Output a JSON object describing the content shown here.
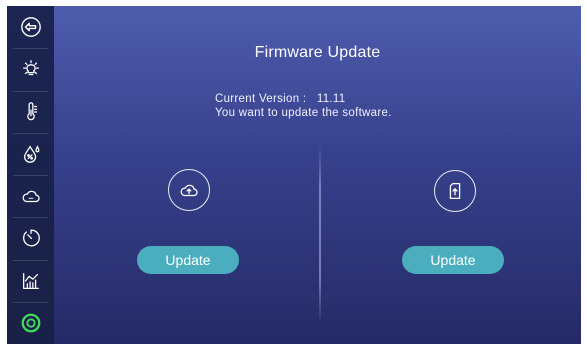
{
  "sidebar": {
    "items": [
      {
        "icon": "back-arrow-icon"
      },
      {
        "icon": "light-bulb-icon"
      },
      {
        "icon": "thermometer-icon"
      },
      {
        "icon": "humidity-icon"
      },
      {
        "icon": "cloud-icon"
      },
      {
        "icon": "timer-icon"
      },
      {
        "icon": "chart-icon"
      },
      {
        "icon": "power-ring-icon"
      }
    ],
    "active_color": "#3ddc5a"
  },
  "main": {
    "title": "Firmware Update",
    "version_label": "Current Version :",
    "version_value": "11.11",
    "prompt": "You want to update the software.",
    "left_panel": {
      "icon": "cloud-upload-icon",
      "button_label": "Update"
    },
    "right_panel": {
      "icon": "file-upload-icon",
      "button_label": "Update"
    }
  },
  "colors": {
    "button": "#4aaebf",
    "sidebar_bg": "#1b2550",
    "main_bg_top": "#4f5dad",
    "main_bg_bottom": "#252a66"
  }
}
